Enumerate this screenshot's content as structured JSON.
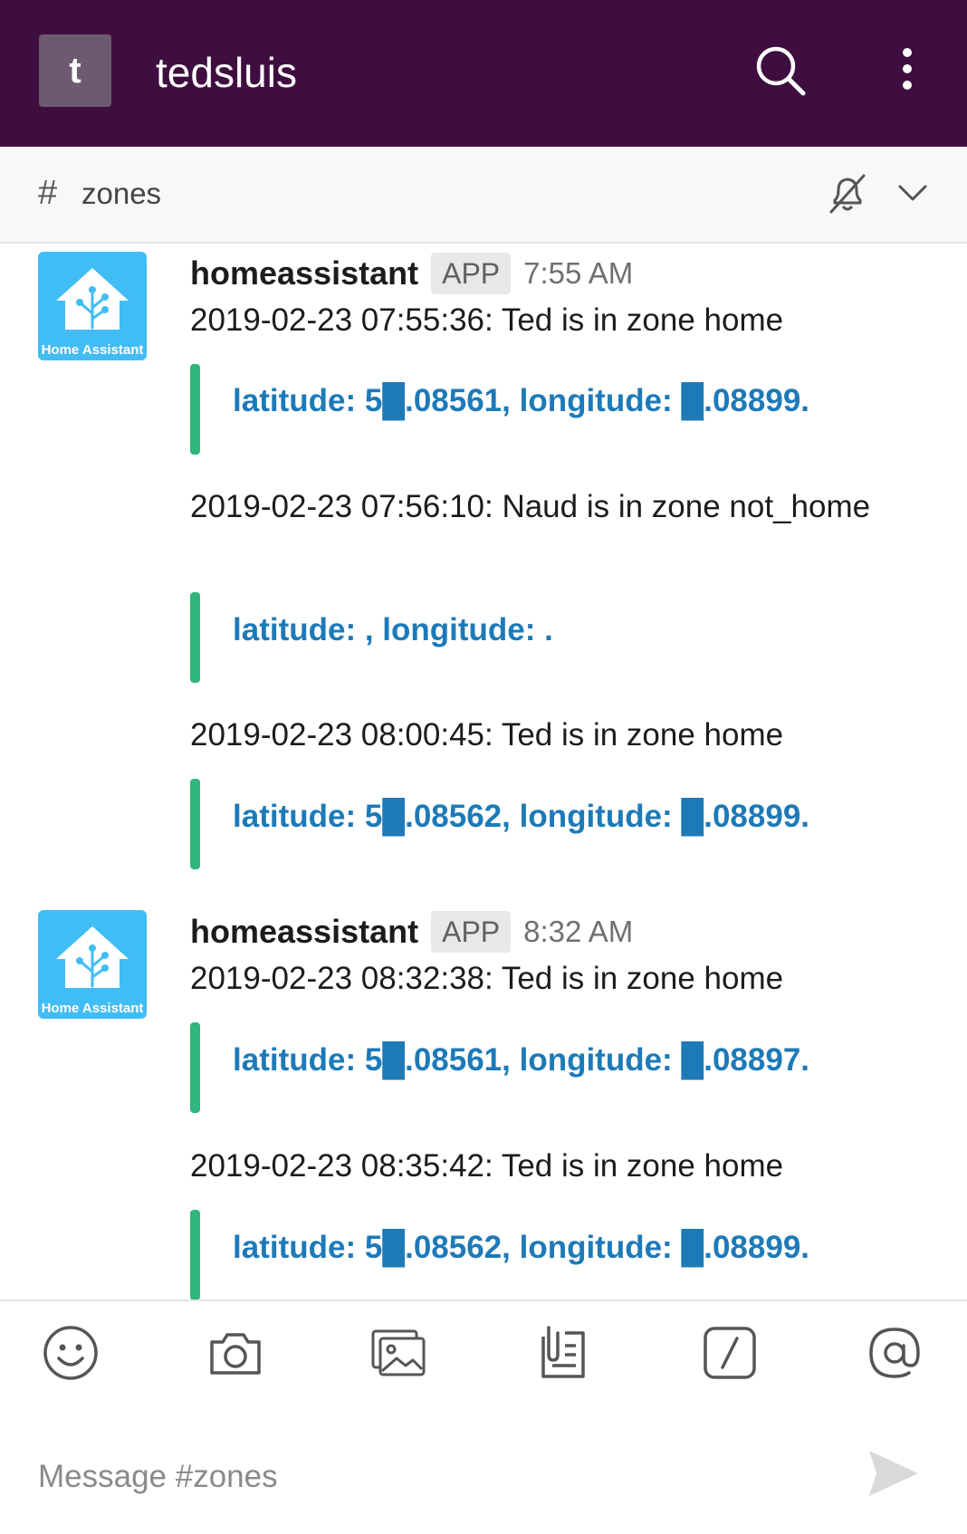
{
  "workspace": {
    "initial": "t",
    "name": "tedsluis"
  },
  "channel": {
    "hash": "#",
    "name": "zones"
  },
  "icons": {
    "search": "search-icon",
    "menu": "more-vertical-icon",
    "mute": "bell-muted-icon",
    "chevron": "chevron-down-icon",
    "emoji": "emoji-icon",
    "camera": "camera-icon",
    "photo": "photo-gallery-icon",
    "files": "file-icon",
    "shortcuts": "slash-command-icon",
    "mention": "at-mention-icon",
    "send": "send-icon"
  },
  "colors": {
    "topbar": "#3f0e40",
    "attachment_bar": "#2eb67d",
    "link": "#1d7ab8",
    "avatar": "#41bdf5"
  },
  "groups": [
    {
      "sender": "homeassistant",
      "badge": "APP",
      "time": "7:55 AM",
      "avatar_label": "Home Assistant",
      "messages": [
        {
          "text": "2019-02-23 07:55:36: Ted is in zone home",
          "attachment": "latitude: 5█.08561, longitude: █.08899."
        },
        {
          "text": "2019-02-23 07:56:10: Naud is in zone not_home",
          "attachment": "latitude: , longitude: ."
        },
        {
          "text": "2019-02-23 08:00:45: Ted is in zone home",
          "attachment": "latitude: 5█.08562, longitude: █.08899."
        }
      ]
    },
    {
      "sender": "homeassistant",
      "badge": "APP",
      "time": "8:32 AM",
      "avatar_label": "Home Assistant",
      "messages": [
        {
          "text": "2019-02-23 08:32:38: Ted is in zone home",
          "attachment": "latitude: 5█.08561, longitude: █.08897."
        },
        {
          "text": "2019-02-23 08:35:42: Ted is in zone home",
          "attachment": "latitude: 5█.08562, longitude: █.08899."
        }
      ]
    }
  ],
  "composer": {
    "placeholder": "Message #zones"
  }
}
